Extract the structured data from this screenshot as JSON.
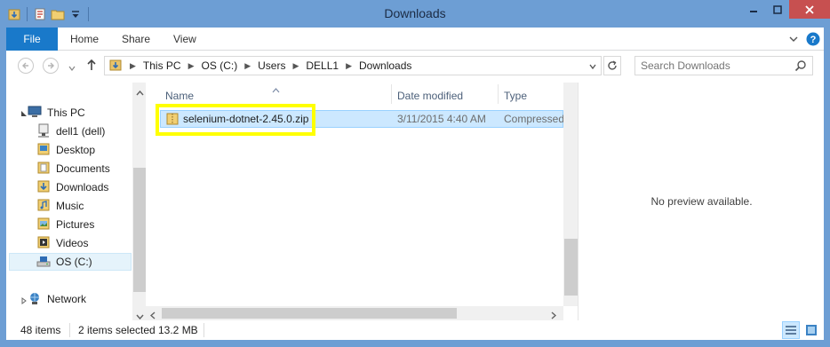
{
  "window": {
    "title": "Downloads"
  },
  "ribbon": {
    "tabs": {
      "file": "File",
      "home": "Home",
      "share": "Share",
      "view": "View"
    }
  },
  "breadcrumb": [
    "This PC",
    "OS (C:)",
    "Users",
    "DELL1",
    "Downloads"
  ],
  "search": {
    "placeholder": "Search Downloads"
  },
  "nav": {
    "this_pc": "This PC",
    "items": [
      "dell1 (dell)",
      "Desktop",
      "Documents",
      "Downloads",
      "Music",
      "Pictures",
      "Videos",
      "OS (C:)"
    ],
    "network": "Network"
  },
  "columns": {
    "name": "Name",
    "date": "Date modified",
    "type": "Type"
  },
  "files": [
    {
      "name": "selenium-dotnet-2.45.0.zip",
      "date": "3/11/2015 4:40 AM",
      "type": "Compressed"
    }
  ],
  "preview": {
    "text": "No preview available."
  },
  "status": {
    "count": "48 items",
    "selected": "2 items selected",
    "size": "13.2 MB"
  },
  "colors": {
    "titlebar": "#6d9ed4",
    "file_tab": "#1979ca",
    "selection": "#cce8ff",
    "highlight": "#ffff00",
    "close": "#c75050"
  }
}
